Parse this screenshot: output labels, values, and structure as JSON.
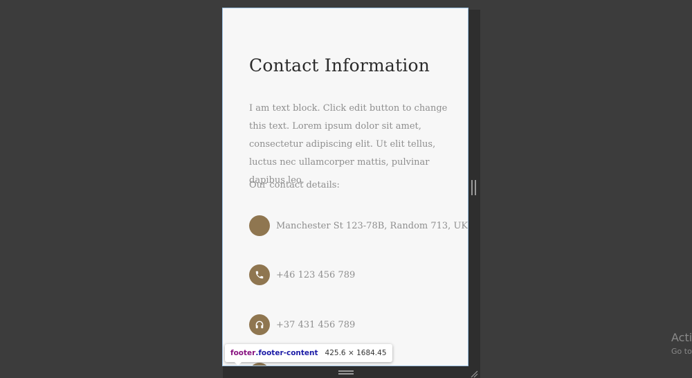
{
  "footer": {
    "title": "Contact Information",
    "body": "I am text block. Click edit button to change this text. Lorem ipsum dolor sit amet, consectetur adipiscing elit. Ut elit tellus, luctus nec ullamcorper mattis, pulvinar dapibus leo.",
    "subtitle": "Our contact details:",
    "items": [
      {
        "icon": "map-marker-icon",
        "text": "Manchester St 123-78B, Random 713, UK"
      },
      {
        "icon": "phone-icon",
        "text": "+46 123 456 789"
      },
      {
        "icon": "headphones-icon",
        "text": "+37 431 456 789"
      },
      {
        "icon": "envelope-icon",
        "text": ""
      }
    ]
  },
  "devtools": {
    "tag": "footer",
    "class_name": ".footer-content",
    "dimensions": "425.6 × 1684.45"
  },
  "watermark": {
    "title": "Activ",
    "subtitle": "Go to"
  },
  "colors": {
    "accent": "#8f7650",
    "page_background": "#3c3c3c",
    "panel_background": "#f7f7f7"
  }
}
